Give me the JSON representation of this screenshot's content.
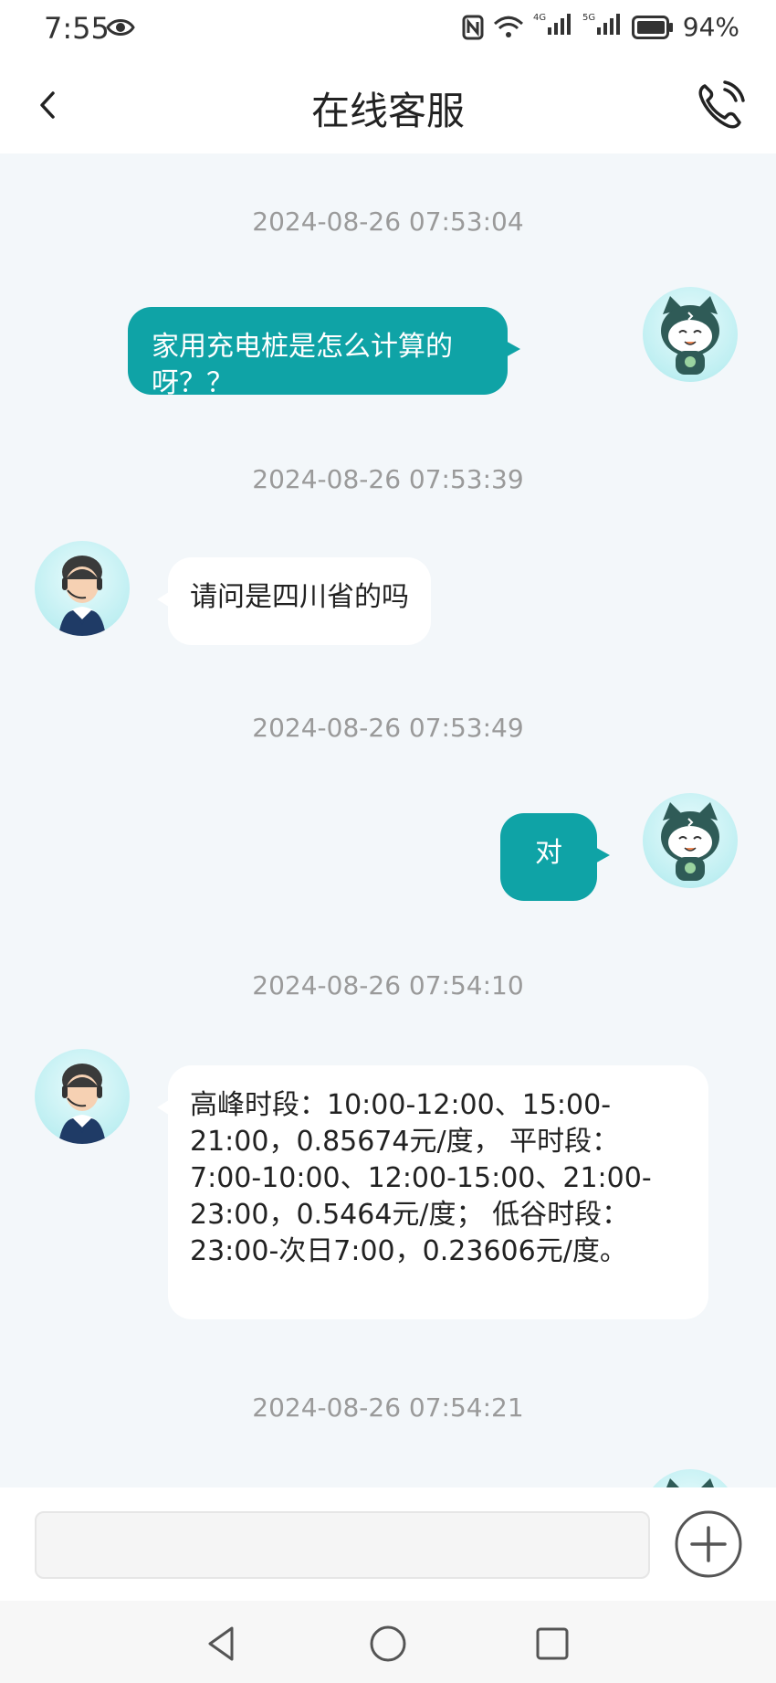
{
  "status": {
    "time": "7:55",
    "battery": "94%",
    "sig1": "4G",
    "sig2": "5G"
  },
  "header": {
    "title": "在线客服"
  },
  "messages": [
    {
      "time": "2024-08-26 07:53:04",
      "text": "家用充电桩是怎么计算的呀？？"
    },
    {
      "time": "2024-08-26 07:53:39",
      "text": "请问是四川省的吗"
    },
    {
      "time": "2024-08-26 07:53:49",
      "text": "对"
    },
    {
      "time": "2024-08-26 07:54:10",
      "text": "高峰时段：10:00-12:00、15:00-21:00，0.85674元/度， 平时段：7:00-10:00、12:00-15:00、21:00-23:00，0.5464元/度； 低谷时段：23:00-次日7:00，0.23606元/度。"
    },
    {
      "time": "2024-08-26 07:54:21"
    }
  ],
  "input": {
    "value": ""
  },
  "colors": {
    "accent": "#0fa3a6"
  }
}
